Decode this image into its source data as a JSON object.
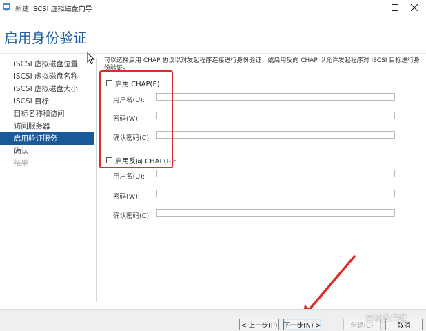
{
  "window": {
    "title": "新建 iSCSI 虚拟磁盘向导",
    "controls": [
      "minimize-icon",
      "maximize-icon",
      "close-icon"
    ]
  },
  "page": {
    "title": "启用身份验证"
  },
  "steps": [
    {
      "label": "iSCSI 虚拟磁盘位置",
      "state": "done"
    },
    {
      "label": "iSCSI 虚拟磁盘名称",
      "state": "done"
    },
    {
      "label": "iSCSI 虚拟磁盘大小",
      "state": "done"
    },
    {
      "label": "iSCSI 目标",
      "state": "done"
    },
    {
      "label": "目标名称和访问",
      "state": "done"
    },
    {
      "label": "访问服务器",
      "state": "done"
    },
    {
      "label": "启用验证服务",
      "state": "active"
    },
    {
      "label": "确认",
      "state": "pending"
    },
    {
      "label": "结果",
      "state": "disabled"
    }
  ],
  "intro": "可以选择启用 CHAP 协议以对发起程序连接进行身份验证，或启用反向 CHAP 以允许发起程序对 iSCSI 目标进行身份验证。",
  "chap": {
    "checkbox_label": "启用 CHAP(E):",
    "checked": false,
    "username_label": "用户名(U):",
    "username_value": "",
    "password_label": "密码(W):",
    "password_value": "",
    "confirm_label": "确认密码(C):",
    "confirm_value": ""
  },
  "reverse_chap": {
    "checkbox_label": "启用反向 CHAP(R):",
    "checked": false,
    "username_label": "用户名(U):",
    "username_value": "",
    "password_label": "密码(W):",
    "password_value": "",
    "confirm_label": "确认密码(C):",
    "confirm_value": ""
  },
  "buttons": {
    "prev": "< 上一步(P)",
    "next": "下一步(N) >",
    "create": "创建(C)",
    "cancel": "取消"
  },
  "watermark": "@凌云共远",
  "colors": {
    "accent": "#1b5a9a",
    "title": "#1f5f9e",
    "annotation": "#e02b2b"
  }
}
